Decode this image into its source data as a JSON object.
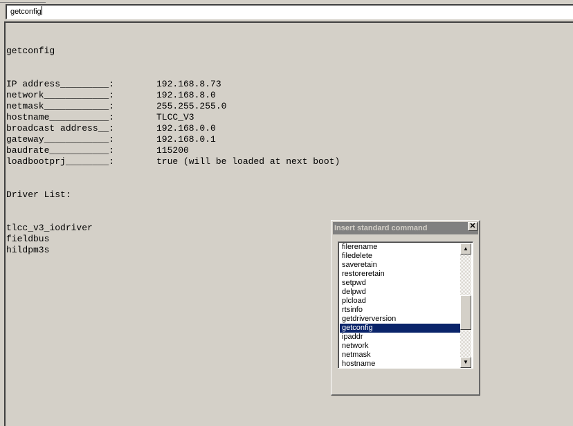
{
  "command_input": {
    "value": "getconfig"
  },
  "output": {
    "command_echo": "getconfig",
    "config_rows": [
      {
        "key": "IP address_________:",
        "value": "192.168.8.73"
      },
      {
        "key": "network____________:",
        "value": "192.168.8.0"
      },
      {
        "key": "netmask____________:",
        "value": "255.255.255.0"
      },
      {
        "key": "hostname___________:",
        "value": "TLCC_V3"
      },
      {
        "key": "broadcast address__:",
        "value": "192.168.0.0"
      },
      {
        "key": "gateway____________:",
        "value": "192.168.0.1"
      },
      {
        "key": "baudrate___________:",
        "value": "115200"
      },
      {
        "key": "loadbootprj________:",
        "value": "true (will be loaded at next boot)"
      }
    ],
    "driver_list_header": "Driver List:",
    "drivers": [
      "tlcc_v3_iodriver",
      "fieldbus",
      "hildpm3s"
    ]
  },
  "dialog": {
    "title": "Insert standard command",
    "close_glyph": "✕",
    "scroll_up_glyph": "▲",
    "scroll_down_glyph": "▼",
    "scroll_position_fraction": 0.6,
    "items": [
      "filerename",
      "filedelete",
      "saveretain",
      "restoreretain",
      "setpwd",
      "delpwd",
      "plcload",
      "rtsinfo",
      "getdriverversion",
      "getconfig",
      "ipaddr",
      "network",
      "netmask",
      "hostname"
    ],
    "selected_item": "getconfig"
  },
  "colors": {
    "background": "#d4d0c8",
    "selection": "#0a246a",
    "title_bar_inactive": "#808080"
  }
}
